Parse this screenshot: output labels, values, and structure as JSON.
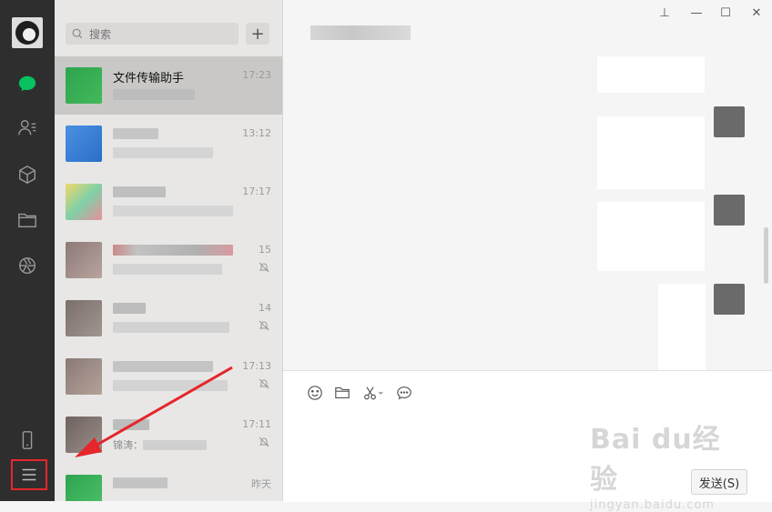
{
  "search": {
    "placeholder": "搜索"
  },
  "toolbar": {
    "add_label": "+"
  },
  "conversations": [
    {
      "name": "文件传输助手",
      "preview": "",
      "time": "17:23",
      "muted": false,
      "selected": true
    },
    {
      "name": "",
      "preview": "",
      "time": "13:12",
      "muted": false,
      "selected": false
    },
    {
      "name": "",
      "preview": "",
      "time": "17:17",
      "muted": false,
      "selected": false
    },
    {
      "name": "",
      "preview": "",
      "time": "15",
      "muted": true,
      "selected": false
    },
    {
      "name": "",
      "preview": "",
      "time": "14",
      "muted": true,
      "selected": false
    },
    {
      "name": "",
      "preview": "",
      "time": "17:13",
      "muted": true,
      "selected": false
    },
    {
      "name": "",
      "preview": "锦涛：",
      "time": "17:11",
      "muted": true,
      "selected": false
    },
    {
      "name": "",
      "preview": "",
      "time": "昨天",
      "muted": false,
      "selected": false
    }
  ],
  "chat": {
    "send_label": "发送(S)"
  },
  "window_controls": {
    "pin": "⊥",
    "minimize": "—",
    "maximize": "☐",
    "close": "✕"
  },
  "watermark": {
    "line1": "Bai du经验",
    "line2": "jingyan.baidu.com"
  },
  "colors": {
    "accent": "#07c160",
    "highlight": "#e5262b",
    "nav_bg": "#2e2e2e"
  }
}
